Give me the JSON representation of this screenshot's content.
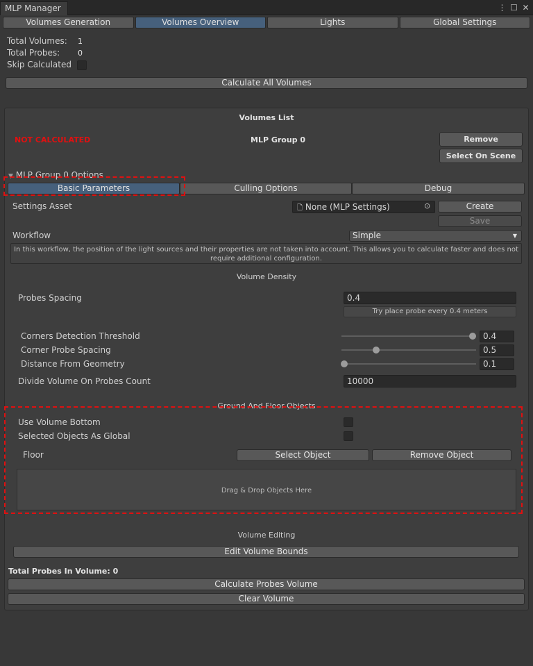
{
  "window": {
    "title": "MLP Manager",
    "icons": [
      "more-icon",
      "maximize-icon",
      "close-icon"
    ]
  },
  "tabs": [
    {
      "label": "Volumes Generation",
      "active": false
    },
    {
      "label": "Volumes Overview",
      "active": true
    },
    {
      "label": "Lights",
      "active": false
    },
    {
      "label": "Global Settings",
      "active": false
    }
  ],
  "summary": {
    "total_volumes_label": "Total Volumes:",
    "total_volumes_value": "1",
    "total_probes_label": "Total Probes:",
    "total_probes_value": "0",
    "skip_calculated_label": "Skip Calculated",
    "skip_calculated_checked": false
  },
  "calculate_all_label": "Calculate All Volumes",
  "volumes_list": {
    "title": "Volumes List",
    "status": "NOT CALCULATED",
    "group_name": "MLP Group 0",
    "remove_label": "Remove",
    "select_on_scene_label": "Select On Scene",
    "options_foldout": "MLP Group 0 Options",
    "subtabs": [
      {
        "label": "Basic Parameters",
        "active": true
      },
      {
        "label": "Culling Options",
        "active": false
      },
      {
        "label": "Debug",
        "active": false
      }
    ]
  },
  "settings_asset": {
    "label": "Settings Asset",
    "value": "None (MLP Settings)",
    "create_label": "Create",
    "save_label": "Save"
  },
  "workflow": {
    "label": "Workflow",
    "value": "Simple",
    "help_line1": "In this workflow, the position of the light sources and their properties are not taken into account. This allows you to calculate faster and does not",
    "help_line2": "require additional configuration."
  },
  "volume_density": {
    "title": "Volume Density",
    "probes_spacing_label": "Probes Spacing",
    "probes_spacing_value": "0.4",
    "probes_spacing_hint": "Try place probe every 0.4 meters",
    "corners_threshold_label": "Corners Detection Threshold",
    "corners_threshold_value": "0.4",
    "corner_spacing_label": "Corner Probe Spacing",
    "corner_spacing_value": "0.5",
    "distance_label": "Distance From Geometry",
    "distance_value": "0.1",
    "divide_label": "Divide Volume On Probes Count",
    "divide_value": "10000"
  },
  "sliders": {
    "corners_threshold_fraction": 1.0,
    "corner_spacing_fraction": 0.26,
    "distance_fraction": 0.0
  },
  "ground": {
    "title": "Ground And Floor Objects",
    "use_volume_bottom_label": "Use Volume Bottom",
    "selected_global_label": "Selected Objects As Global",
    "floor_label": "Floor",
    "select_object_label": "Select Object",
    "remove_object_label": "Remove Object",
    "dropzone_label": "Drag & Drop Objects Here"
  },
  "volume_editing": {
    "title": "Volume Editing",
    "edit_bounds_label": "Edit Volume Bounds",
    "total_probes_label": "Total Probes In Volume: 0",
    "calculate_label": "Calculate Probes Volume",
    "clear_label": "Clear Volume"
  },
  "colors": {
    "background": "#383838",
    "active_tab": "#46607c",
    "status_red": "#e01010",
    "highlight_dashed": "#e01010"
  }
}
